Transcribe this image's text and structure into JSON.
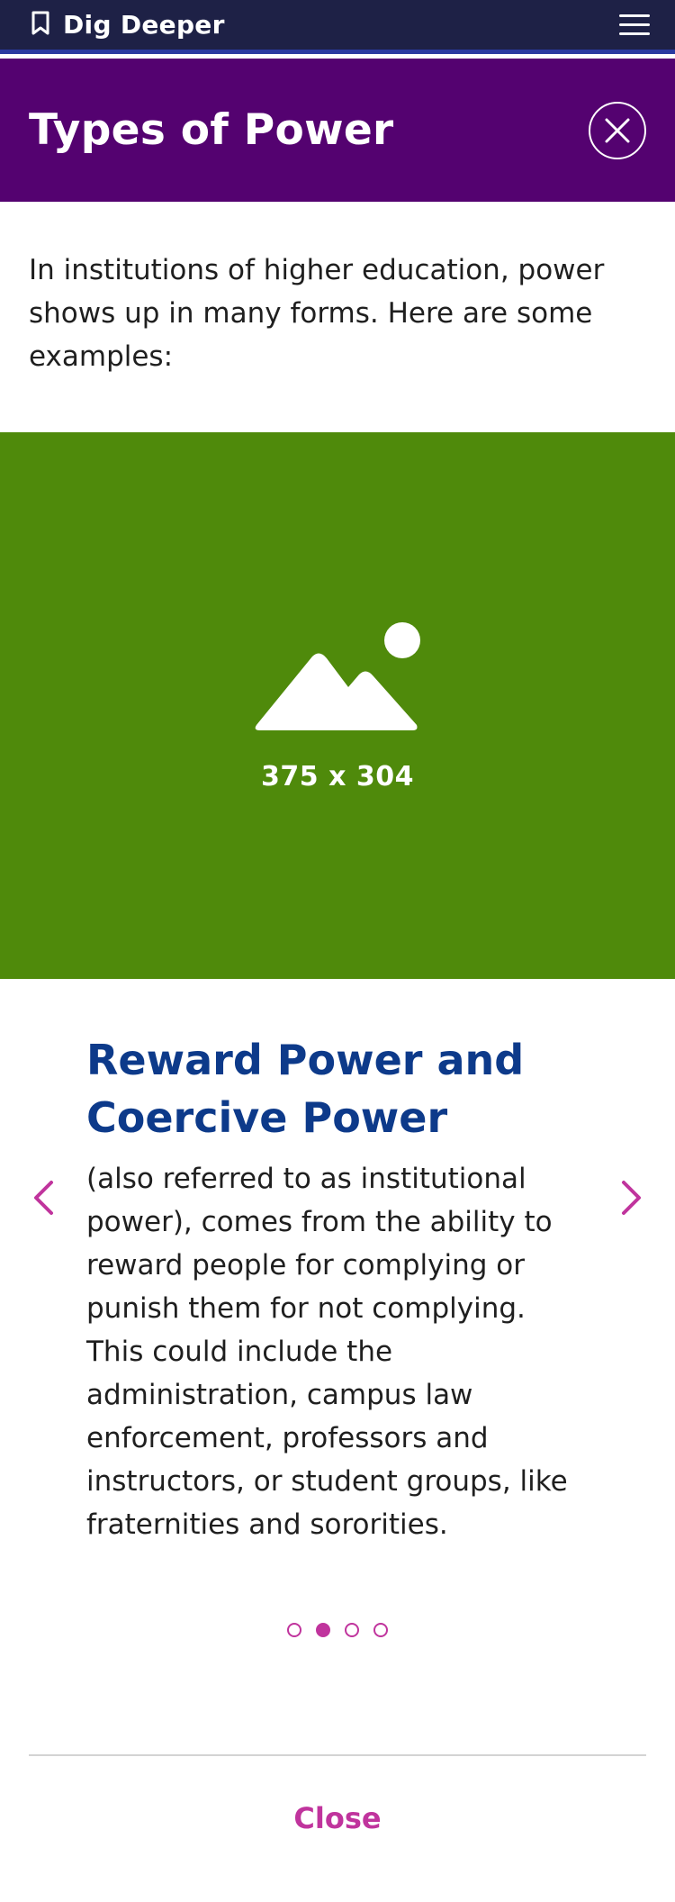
{
  "topbar": {
    "brand_label": "Dig Deeper",
    "brand_icon": "bookmark-icon",
    "menu_icon": "hamburger-menu-icon"
  },
  "header": {
    "title": "Types of Power",
    "close_icon": "close-icon"
  },
  "intro": {
    "text": "In institutions of higher education, power shows up in many forms. Here are some examples:"
  },
  "media": {
    "placeholder_icon": "image-placeholder-icon",
    "caption": "375 x 304",
    "background_color": "#4f8a0b"
  },
  "carousel": {
    "title": "Reward Power and Coercive Power",
    "body": "(also referred to as institutional power), comes from the ability to reward people for complying or punish them for not complying. This could include the administration, campus law enforcement, professors and instructors, or student groups, like fraternities and sororities.",
    "prev_icon": "chevron-left-icon",
    "next_icon": "chevron-right-icon",
    "slide_count": 4,
    "active_index": 2
  },
  "footer": {
    "close_label": "Close"
  },
  "colors": {
    "topbar": "#1e2146",
    "header": "#540270",
    "accent": "#c0349d",
    "title": "#0d3a8a"
  }
}
